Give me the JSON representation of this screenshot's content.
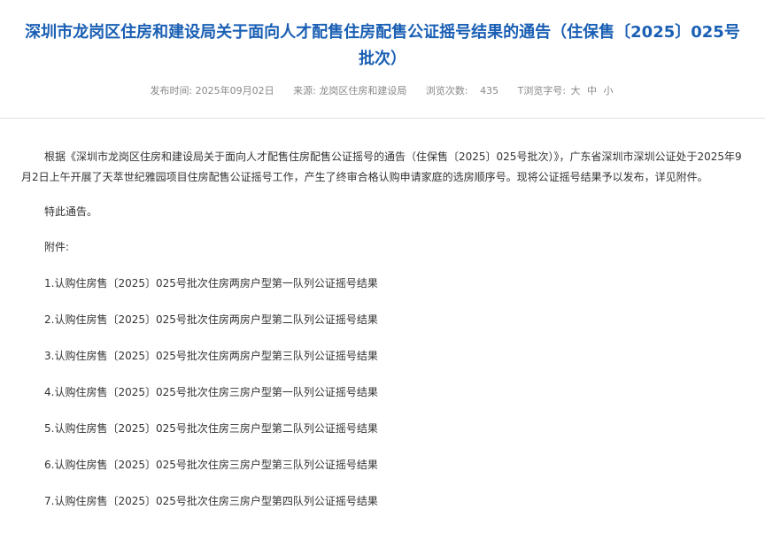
{
  "article": {
    "title": "深圳市龙岗区住房和建设局关于面向人才配售住房配售公证摇号结果的通告（住保售〔2025〕025号批次）",
    "meta": {
      "publish_label": "发布时间:",
      "publish_date": "2025年09月02日",
      "source_label": "来源:",
      "source": "龙岗区住房和建设局",
      "views_label": "浏览次数:",
      "views": "435",
      "font_label": "T浏览字号:",
      "font_large": "大",
      "font_medium": "中",
      "font_small": "小"
    },
    "body": {
      "intro": "根据《深圳市龙岗区住房和建设局关于面向人才配售住房配售公证摇号的通告（住保售〔2025〕025号批次）》，广东省深圳市深圳公证处于2025年9月2日上午开展了天萃世纪雅园项目住房配售公证摇号工作，产生了终审合格认购申请家庭的选房顺序号。现将公证摇号结果予以发布，详见附件。",
      "notice": "特此通告。",
      "attachments_label": "附件:",
      "attachments": [
        "1.认购住房售〔2025〕025号批次住房两房户型第一队列公证摇号结果",
        "2.认购住房售〔2025〕025号批次住房两房户型第二队列公证摇号结果",
        "3.认购住房售〔2025〕025号批次住房两房户型第三队列公证摇号结果",
        "4.认购住房售〔2025〕025号批次住房三房户型第一队列公证摇号结果",
        "5.认购住房售〔2025〕025号批次住房三房户型第二队列公证摇号结果",
        "6.认购住房售〔2025〕025号批次住房三房户型第三队列公证摇号结果",
        "7.认购住房售〔2025〕025号批次住房三房户型第四队列公证摇号结果"
      ]
    }
  },
  "colors": {
    "title": "#1a5fb4",
    "meta_text": "#888888",
    "body_text": "#333333",
    "divider": "#e2e2e2"
  }
}
